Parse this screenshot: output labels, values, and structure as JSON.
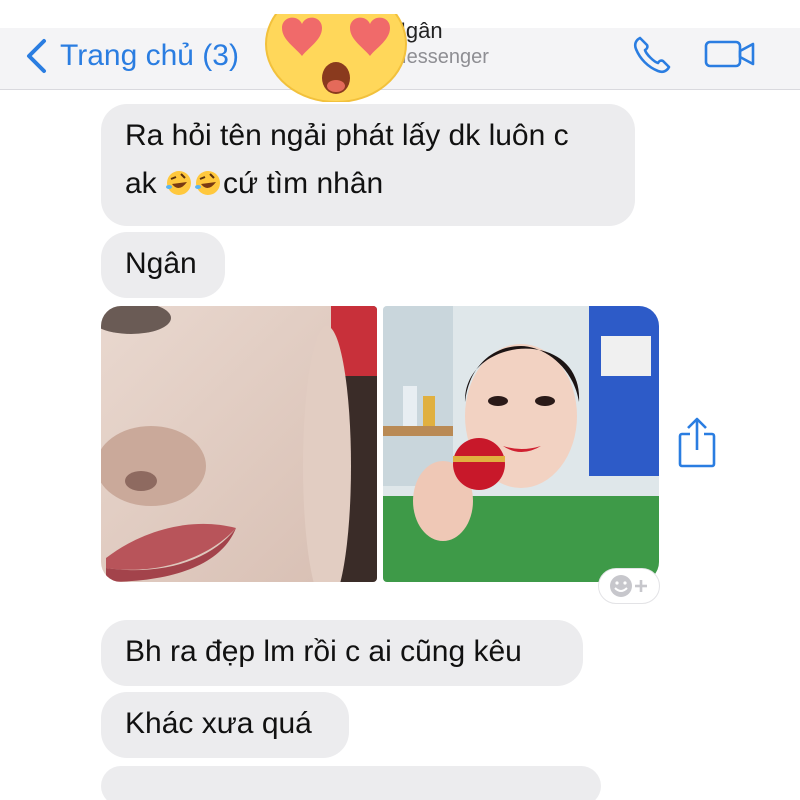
{
  "header": {
    "back_label": "Trang chủ (3)",
    "contact_name": "Ngân",
    "contact_subtitle": "Messenger",
    "icons": [
      "chevron-left-icon",
      "phone-icon",
      "video-camera-icon"
    ]
  },
  "overlay": {
    "emoji": "heart-eyes-emoji"
  },
  "messages": [
    {
      "line1": "Ra hỏi tên ngải phát lấy dk luôn c",
      "line2_prefix": "ak",
      "line2_suffix": "cứ tìm nhân",
      "emojis": [
        "rofl-emoji",
        "rofl-emoji"
      ]
    },
    {
      "text": "Ngân"
    },
    {
      "photos": [
        "face-closeup-photo",
        "selfie-with-cream-jar-photo"
      ]
    },
    {
      "text": "Bh ra đẹp lm rồi c ai cũng kêu"
    },
    {
      "text": "Khác xưa quá"
    }
  ],
  "colors": {
    "accent": "#2a7de1",
    "bubble": "#ececee",
    "header": "#f4f4f6",
    "text": "#111111"
  }
}
